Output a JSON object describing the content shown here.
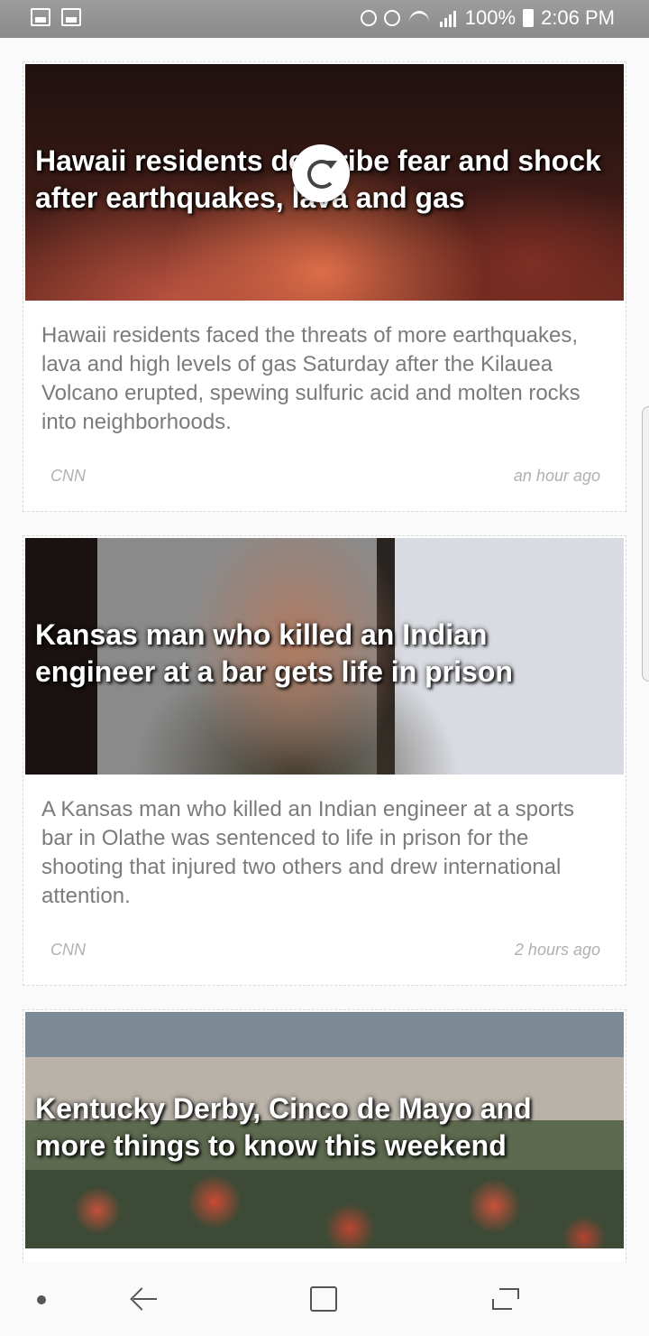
{
  "status_bar": {
    "battery": "100%",
    "time": "2:06 PM"
  },
  "articles": [
    {
      "headline": "Hawaii residents describe fear and shock after earthquakes, lava and gas",
      "summary": "Hawaii residents faced the threats of more earthquakes, lava and high levels of gas Saturday after the Kilauea Volcano erupted, spewing sulfuric acid and molten rocks into neighborhoods.",
      "source": "CNN",
      "time": "an hour ago"
    },
    {
      "headline": "Kansas man who killed an Indian engineer at a bar gets life in prison",
      "summary": "A Kansas man who killed an Indian engineer at a sports bar in Olathe was sentenced to life in prison for the shooting that injured two others and drew international attention.",
      "source": "CNN",
      "time": "2 hours ago"
    },
    {
      "headline": "Kentucky Derby, Cinco de Mayo and more things to know this weekend",
      "summary": "",
      "source": "",
      "time": ""
    }
  ],
  "icons": {
    "refresh": "refresh-icon",
    "nav_back": "back-icon",
    "nav_home": "home-icon",
    "nav_recent": "recent-apps-icon"
  }
}
